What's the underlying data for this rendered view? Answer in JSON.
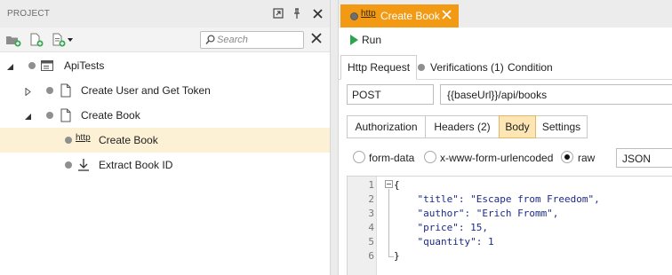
{
  "project_panel": {
    "title": "PROJECT",
    "search_placeholder": "Search",
    "tree": [
      {
        "label": "ApiTests",
        "type": "project",
        "expanded": true
      },
      {
        "label": "Create User and Get Token",
        "type": "test",
        "expanded": false
      },
      {
        "label": "Create Book",
        "type": "test",
        "expanded": true
      },
      {
        "label": "Create Book",
        "type": "http-step",
        "icon_text": "http",
        "selected": true
      },
      {
        "label": "Extract Book ID",
        "type": "extract-step"
      }
    ]
  },
  "editor_tab": {
    "icon_text": "http",
    "label": "Create Book"
  },
  "run_label": "Run",
  "sub_tabs": {
    "http_request": "Http Request",
    "verifications": "Verifications (1)",
    "condition": "Condition"
  },
  "request": {
    "method": "POST",
    "url": "{{baseUrl}}/api/books"
  },
  "request_tabs": {
    "authorization": "Authorization",
    "headers": "Headers (2)",
    "body": "Body",
    "settings": "Settings"
  },
  "body_type": {
    "form_data": "form-data",
    "urlencoded": "x-www-form-urlencoded",
    "raw": "raw",
    "selected": "raw",
    "format": "JSON"
  },
  "code": {
    "line_numbers": [
      "1",
      "2",
      "3",
      "4",
      "5",
      "6"
    ],
    "lines": [
      "{",
      "    \"title\": \"Escape from Freedom\",",
      "    \"author\": \"Erich Fromm\",",
      "    \"price\": 15,",
      "    \"quantity\": 1",
      "}"
    ]
  },
  "colors": {
    "accent_tab": "#f29a13",
    "selected_row": "#fdf1d5",
    "active_segment": "#fde6b4",
    "run_green": "#2ea44f"
  }
}
